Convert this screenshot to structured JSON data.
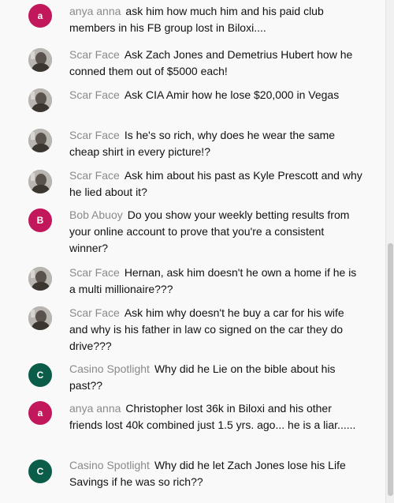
{
  "messages": [
    {
      "author": "anya anna",
      "avatar_letter": "a",
      "avatar_type": "letter",
      "avatar_color": "#c2185b",
      "text": "ask him how much him and his paid club members in his FB group lost in Biloxi...."
    },
    {
      "author": "Scar Face",
      "avatar_letter": "",
      "avatar_type": "photo",
      "avatar_color": "#9a9a9a",
      "text": "Ask Zach Jones and Demetrius Hubert how he conned them out of $5000 each!"
    },
    {
      "author": "Scar Face",
      "avatar_letter": "",
      "avatar_type": "photo",
      "avatar_color": "#9a9a9a",
      "text": "Ask CIA Amir how he lose $20,000 in Vegas"
    },
    {
      "author": "Scar Face",
      "avatar_letter": "",
      "avatar_type": "photo",
      "avatar_color": "#9a9a9a",
      "text": "Is he's so rich, why does he wear the same cheap shirt in every picture!?"
    },
    {
      "author": "Scar Face",
      "avatar_letter": "",
      "avatar_type": "photo",
      "avatar_color": "#9a9a9a",
      "text": "Ask him about his past as Kyle Prescott and why he lied about it?"
    },
    {
      "author": "Bob Abuoy",
      "avatar_letter": "B",
      "avatar_type": "letter",
      "avatar_color": "#c2185b",
      "text": "Do you show your weekly betting results from your online account to prove that you're a consistent winner?"
    },
    {
      "author": "Scar Face",
      "avatar_letter": "",
      "avatar_type": "photo",
      "avatar_color": "#9a9a9a",
      "text": "Hernan, ask him doesn't he own a home if he is a multi millionaire???"
    },
    {
      "author": "Scar Face",
      "avatar_letter": "",
      "avatar_type": "photo",
      "avatar_color": "#9a9a9a",
      "text": "Ask him why doesn't he buy a car for his wife and why is his father in law co signed on the car they do drive???"
    },
    {
      "author": "Casino Spotlight",
      "avatar_letter": "C",
      "avatar_type": "letter",
      "avatar_color": "#0b5d4a",
      "text": "Why did he Lie on the bible about his past??"
    },
    {
      "author": "anya anna",
      "avatar_letter": "a",
      "avatar_type": "letter",
      "avatar_color": "#c2185b",
      "text": "Christopher lost 36k in Biloxi and his other friends lost 40k combined just 1.5 yrs. ago... he is a liar......"
    },
    {
      "author": "Casino Spotlight",
      "avatar_letter": "C",
      "avatar_type": "letter",
      "avatar_color": "#0b5d4a",
      "text": "Why did he let Zach Jones lose his Life Savings if he was so rich??"
    }
  ]
}
